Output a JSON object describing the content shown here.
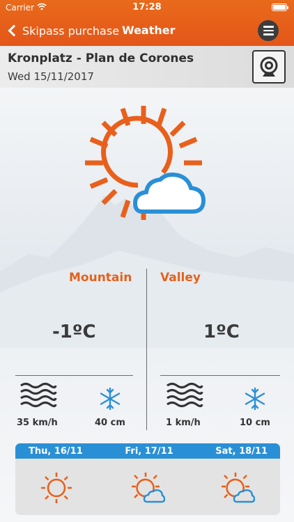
{
  "status": {
    "carrier": "Carrier",
    "time": "17:28"
  },
  "nav": {
    "back_label": "Skipass purchase",
    "title": "Weather"
  },
  "location": {
    "name": "Kronplatz - Plan de Corones",
    "date": "Wed 15/11/2017"
  },
  "columns": {
    "mountain": {
      "title": "Mountain",
      "temperature": "-1ºC",
      "wind": "35 km/h",
      "snow": "40 cm"
    },
    "valley": {
      "title": "Valley",
      "temperature": "1ºC",
      "wind": "1 km/h",
      "snow": "10 cm"
    }
  },
  "forecast": [
    {
      "label": "Thu, 16/11",
      "icon": "sun-icon"
    },
    {
      "label": "Fri, 17/11",
      "icon": "sun-cloud-icon"
    },
    {
      "label": "Sat, 18/11",
      "icon": "sun-cloud-icon"
    }
  ],
  "colors": {
    "accent": "#e3621c",
    "forecast_bar": "#2a90d6",
    "cloud": "#2a8fd6"
  },
  "main_weather_icon": "sun-cloud-icon"
}
